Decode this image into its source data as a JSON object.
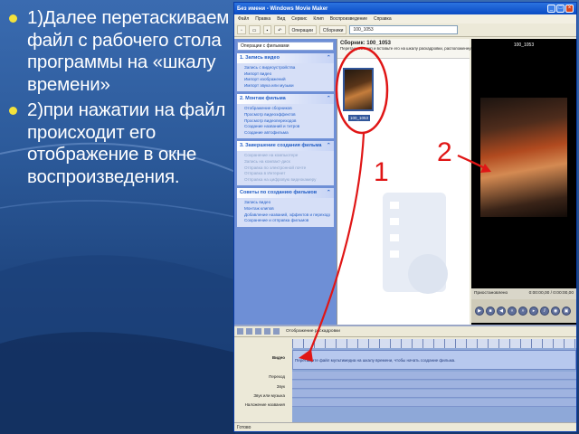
{
  "slide": {
    "bullets": [
      "1)Далее перетаскиваем файл с рабочего стола программы на «шкалу времени»",
      "2)при нажатии на файл  происходит его отображение в окне воспроизведения."
    ],
    "bullet_color": "#f3e23c",
    "background_color": "#2c5a9a"
  },
  "app": {
    "title": "Без имени - Windows Movie Maker",
    "menu": [
      "Файл",
      "Правка",
      "Вид",
      "Сервис",
      "Клип",
      "Воспроизведение",
      "Справка"
    ],
    "toolbar": {
      "tasks_label": "Операции",
      "collections_label": "Сборники",
      "collection_select": "100_1053"
    },
    "taskpane": {
      "header": "Операции с фильмами",
      "sections": [
        {
          "title": "1. Запись видео",
          "items": [
            "Запись с видеоустройства",
            "Импорт видео",
            "Импорт изображений",
            "Импорт звука или музыки"
          ],
          "enabled": true
        },
        {
          "title": "2. Монтаж фильма",
          "items": [
            "Отображение сборников",
            "Просмотр видеоэффектов",
            "Просмотр видеопереходов",
            "Создание названий и титров",
            "Создание автофильма"
          ],
          "enabled": true
        },
        {
          "title": "3. Завершение создания фильма",
          "items": [
            "Сохранение на компьютере",
            "Запись на компакт-диск",
            "Отправка по электронной почте",
            "Отправка в Интернет",
            "Отправка на цифровую видеокамеру"
          ],
          "enabled": false
        },
        {
          "title": "Советы по созданию фильмов",
          "items": [
            "Запись видео",
            "Монтаж клипов",
            "Добавление названий, эффектов и переходов",
            "Сохранение и отправка фильмов"
          ],
          "enabled": true
        }
      ]
    },
    "collection": {
      "title": "Сборник: 100_1053",
      "hint": "Перетащите клип и вставьте его на шкалу раскадровки, расположенную ниже.",
      "clip_label": "100_1053"
    },
    "monitor": {
      "title": "100_1053",
      "status": "Приостановлено",
      "time": "0:00:00,00 / 0:00:00,00"
    },
    "timeline": {
      "toolbar_label": "Отображение раскадровки",
      "tracks": [
        "Видео",
        "Переход",
        "Звук",
        "Звук или музыка",
        "Наложение названия"
      ],
      "drop_hint": "Перетащите файл мультимедиа на шкалу времени, чтобы начать создание фильма."
    },
    "status": "Готово"
  },
  "annotations": {
    "labels": [
      "1",
      "2"
    ],
    "color": "#e01616"
  }
}
